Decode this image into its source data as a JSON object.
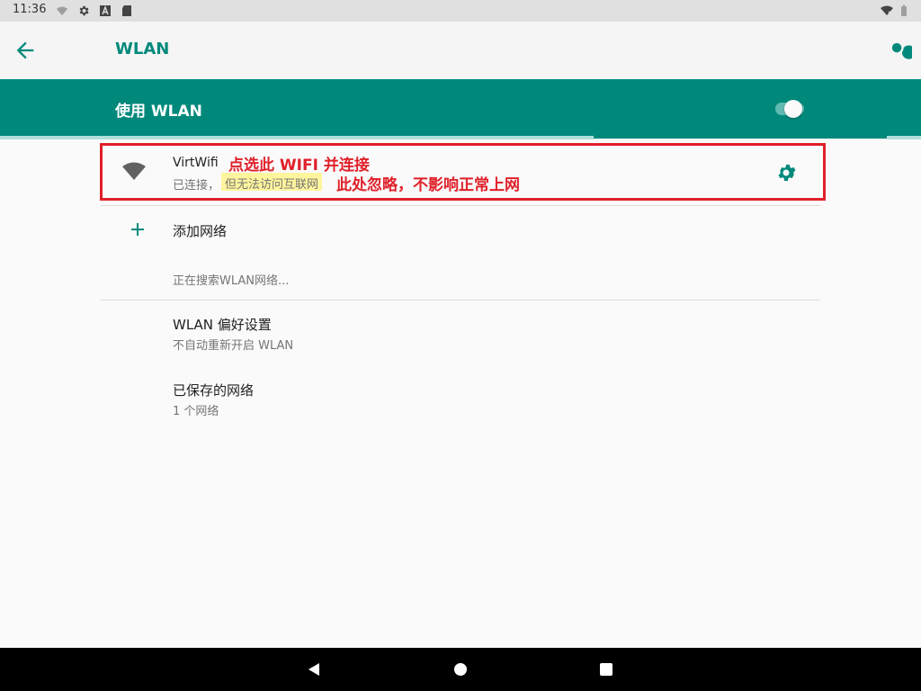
{
  "status_bar": {
    "time": "11:36",
    "left_icons": [
      "wifi-off-icon",
      "gear-icon",
      "a-badge-icon",
      "sd-card-icon"
    ],
    "right_icons": [
      "wifi-x-icon",
      "battery-icon"
    ]
  },
  "app_bar": {
    "title": "WLAN",
    "back_icon": "arrow-back-icon",
    "search_icon": "search-icon"
  },
  "master_switch": {
    "label": "使用 WLAN",
    "on": true
  },
  "connected_network": {
    "name": "VirtWifi",
    "status_prefix": "已连接，",
    "status_highlight": "但无法访问互联网",
    "signal_icon": "wifi-signal-icon",
    "settings_icon": "gear-icon"
  },
  "annotations": {
    "line1": "点选此 WIFI 并连接",
    "line2": "此处忽略，不影响正常上网",
    "color": "#e0202a"
  },
  "add_network": {
    "label": "添加网络",
    "icon": "plus-icon"
  },
  "searching_text": "正在搜索WLAN网络...",
  "preferences": {
    "title": "WLAN 偏好设置",
    "subtitle": "不自动重新开启 WLAN"
  },
  "saved_networks": {
    "title": "已保存的网络",
    "subtitle": "1 个网络"
  },
  "nav_bar": {
    "buttons": [
      "back-triangle-icon",
      "home-circle-icon",
      "recents-square-icon"
    ]
  },
  "colors": {
    "accent": "#00897b",
    "highlight": "#fff59d"
  }
}
